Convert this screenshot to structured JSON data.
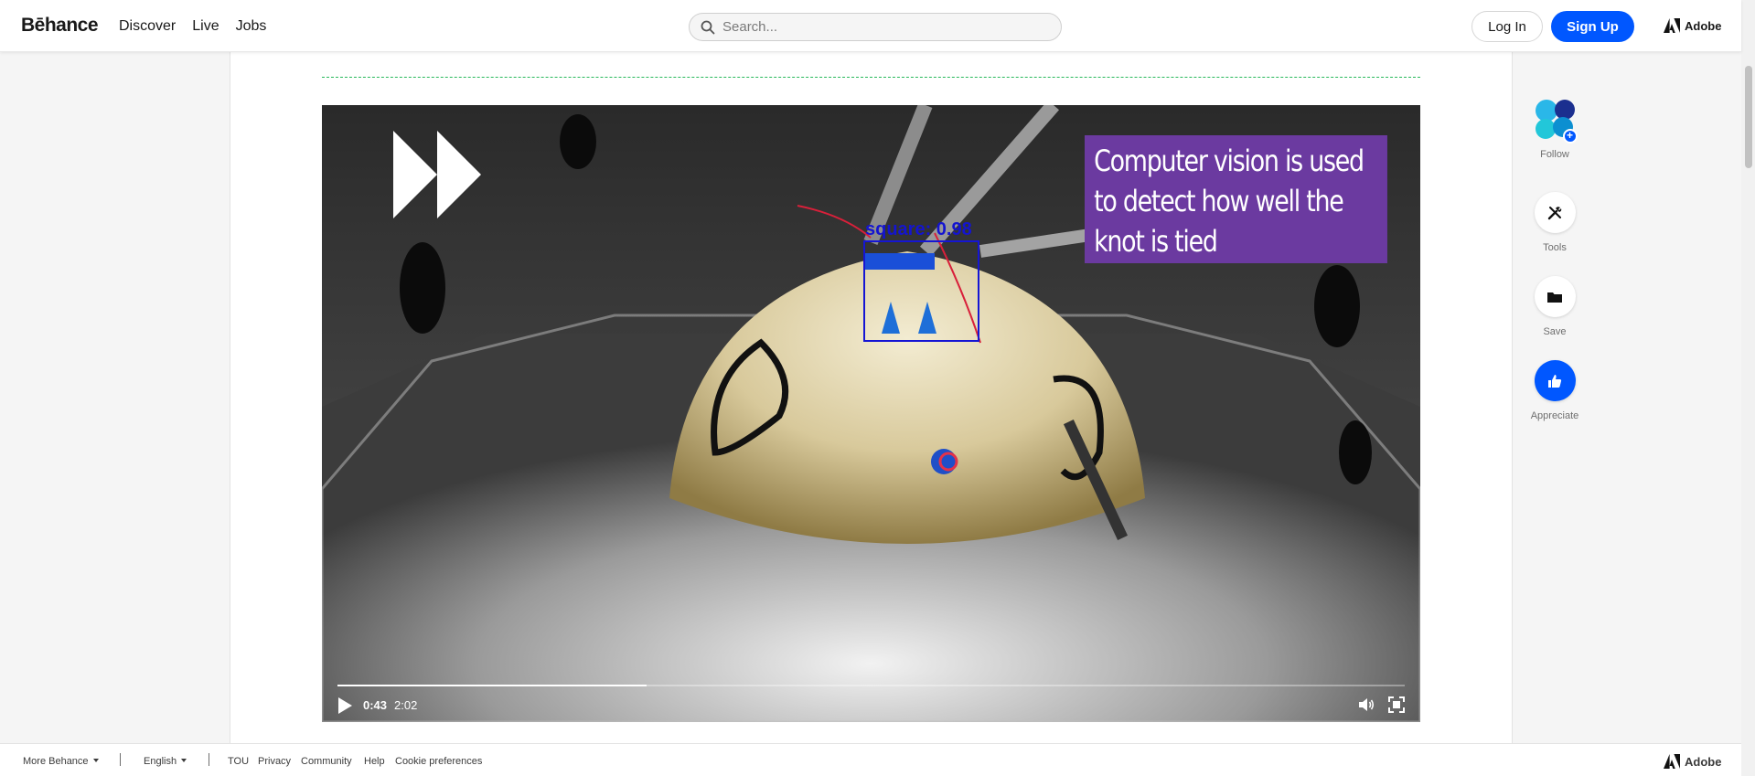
{
  "header": {
    "logo": "Bēhance",
    "nav": [
      "Discover",
      "Live",
      "Jobs"
    ],
    "search_placeholder": "Search...",
    "login_label": "Log In",
    "signup_label": "Sign Up",
    "adobe_label": "Adobe"
  },
  "video": {
    "caption": "Computer vision is used to detect how well the knot is tied",
    "detection_label": "square: 0.98",
    "current_time": "0:43",
    "duration": "2:02",
    "progress": 0.29
  },
  "rail": {
    "follow_label": "Follow",
    "tools_label": "Tools",
    "save_label": "Save",
    "appreciate_label": "Appreciate"
  },
  "footer": {
    "more_behance": "More Behance",
    "language": "English",
    "links": [
      "TOU",
      "Privacy",
      "Community",
      "Help",
      "Cookie preferences"
    ],
    "adobe_label": "Adobe"
  },
  "colors": {
    "accent": "#0057ff",
    "caption_bg": "#6b3aa0",
    "divider": "#28b85a"
  }
}
